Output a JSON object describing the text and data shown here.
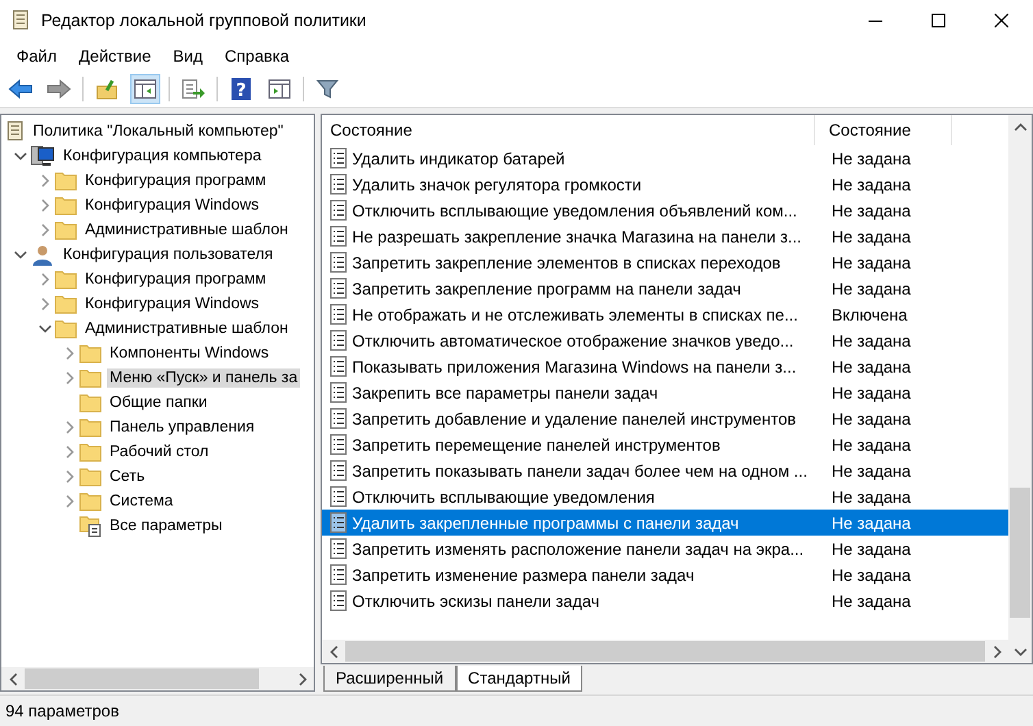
{
  "window": {
    "title": "Редактор локальной групповой политики"
  },
  "menu": [
    "Файл",
    "Действие",
    "Вид",
    "Справка"
  ],
  "toolbar": {
    "help_glyph": "?"
  },
  "tree": [
    {
      "label": "Политика \"Локальный компьютер\"",
      "kind": "policy",
      "selected": false,
      "children": [
        {
          "label": "Конфигурация компьютера",
          "kind": "computer",
          "expandable": true,
          "expanded": true,
          "selected": false,
          "children": [
            {
              "label": "Конфигурация программ",
              "kind": "folder",
              "expandable": true,
              "expanded": false,
              "selected": false
            },
            {
              "label": "Конфигурация Windows",
              "kind": "folder",
              "expandable": true,
              "expanded": false,
              "selected": false
            },
            {
              "label": "Административные шаблон",
              "kind": "folder",
              "expandable": true,
              "expanded": false,
              "selected": false
            }
          ]
        },
        {
          "label": "Конфигурация пользователя",
          "kind": "user",
          "expandable": true,
          "expanded": true,
          "selected": false,
          "children": [
            {
              "label": "Конфигурация программ",
              "kind": "folder",
              "expandable": true,
              "expanded": false,
              "selected": false
            },
            {
              "label": "Конфигурация Windows",
              "kind": "folder",
              "expandable": true,
              "expanded": false,
              "selected": false
            },
            {
              "label": "Административные шаблон",
              "kind": "folder",
              "expandable": true,
              "expanded": true,
              "selected": false,
              "children": [
                {
                  "label": "Компоненты Windows",
                  "kind": "folder",
                  "expandable": true,
                  "expanded": false,
                  "selected": false
                },
                {
                  "label": "Меню «Пуск» и панель за",
                  "kind": "folder",
                  "expandable": true,
                  "expanded": false,
                  "selected": true
                },
                {
                  "label": "Общие папки",
                  "kind": "folder",
                  "expandable": false,
                  "expanded": false,
                  "selected": false
                },
                {
                  "label": "Панель управления",
                  "kind": "folder",
                  "expandable": true,
                  "expanded": false,
                  "selected": false
                },
                {
                  "label": "Рабочий стол",
                  "kind": "folder",
                  "expandable": true,
                  "expanded": false,
                  "selected": false
                },
                {
                  "label": "Сеть",
                  "kind": "folder",
                  "expandable": true,
                  "expanded": false,
                  "selected": false
                },
                {
                  "label": "Система",
                  "kind": "folder",
                  "expandable": true,
                  "expanded": false,
                  "selected": false
                },
                {
                  "label": "Все параметры",
                  "kind": "settings",
                  "expandable": false,
                  "expanded": false,
                  "selected": false
                }
              ]
            }
          ]
        }
      ]
    }
  ],
  "table": {
    "columns": [
      "Состояние",
      "Состояние"
    ],
    "rows": [
      {
        "name": "Удалить индикатор батарей",
        "state": "Не задана",
        "selected": false
      },
      {
        "name": "Удалить значок регулятора громкости",
        "state": "Не задана",
        "selected": false
      },
      {
        "name": "Отключить всплывающие уведомления объявлений ком...",
        "state": "Не задана",
        "selected": false
      },
      {
        "name": "Не разрешать закрепление значка Магазина на панели з...",
        "state": "Не задана",
        "selected": false
      },
      {
        "name": "Запретить закрепление элементов в списках переходов",
        "state": "Не задана",
        "selected": false
      },
      {
        "name": "Запретить закрепление программ на панели задач",
        "state": "Не задана",
        "selected": false
      },
      {
        "name": "Не отображать и не отслеживать элементы в списках пе...",
        "state": "Включена",
        "selected": false
      },
      {
        "name": "Отключить автоматическое отображение значков уведо...",
        "state": "Не задана",
        "selected": false
      },
      {
        "name": "Показывать приложения Магазина Windows на панели з...",
        "state": "Не задана",
        "selected": false
      },
      {
        "name": "Закрепить все параметры панели задач",
        "state": "Не задана",
        "selected": false
      },
      {
        "name": "Запретить добавление и удаление панелей инструментов",
        "state": "Не задана",
        "selected": false
      },
      {
        "name": "Запретить перемещение панелей инструментов",
        "state": "Не задана",
        "selected": false
      },
      {
        "name": "Запретить показывать панели задач более чем на одном ...",
        "state": "Не задана",
        "selected": false
      },
      {
        "name": "Отключить всплывающие уведомления",
        "state": "Не задана",
        "selected": false
      },
      {
        "name": "Удалить закрепленные программы с панели задач",
        "state": "Не задана",
        "selected": true
      },
      {
        "name": "Запретить изменять расположение панели задач на экра...",
        "state": "Не задана",
        "selected": false
      },
      {
        "name": "Запретить изменение размера панели задач",
        "state": "Не задана",
        "selected": false
      },
      {
        "name": "Отключить эскизы панели задач",
        "state": "Не задана",
        "selected": false
      }
    ]
  },
  "tabs": [
    {
      "label": "Расширенный",
      "selected": false
    },
    {
      "label": "Стандартный",
      "selected": true
    }
  ],
  "status_bar": "94 параметров"
}
